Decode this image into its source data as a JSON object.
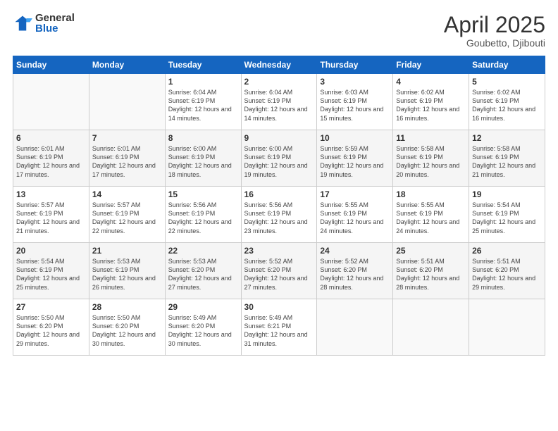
{
  "logo": {
    "general": "General",
    "blue": "Blue"
  },
  "title": {
    "month": "April 2025",
    "location": "Goubetto, Djibouti"
  },
  "headers": [
    "Sunday",
    "Monday",
    "Tuesday",
    "Wednesday",
    "Thursday",
    "Friday",
    "Saturday"
  ],
  "weeks": [
    [
      {
        "day": "",
        "info": ""
      },
      {
        "day": "",
        "info": ""
      },
      {
        "day": "1",
        "info": "Sunrise: 6:04 AM\nSunset: 6:19 PM\nDaylight: 12 hours and 14 minutes."
      },
      {
        "day": "2",
        "info": "Sunrise: 6:04 AM\nSunset: 6:19 PM\nDaylight: 12 hours and 14 minutes."
      },
      {
        "day": "3",
        "info": "Sunrise: 6:03 AM\nSunset: 6:19 PM\nDaylight: 12 hours and 15 minutes."
      },
      {
        "day": "4",
        "info": "Sunrise: 6:02 AM\nSunset: 6:19 PM\nDaylight: 12 hours and 16 minutes."
      },
      {
        "day": "5",
        "info": "Sunrise: 6:02 AM\nSunset: 6:19 PM\nDaylight: 12 hours and 16 minutes."
      }
    ],
    [
      {
        "day": "6",
        "info": "Sunrise: 6:01 AM\nSunset: 6:19 PM\nDaylight: 12 hours and 17 minutes."
      },
      {
        "day": "7",
        "info": "Sunrise: 6:01 AM\nSunset: 6:19 PM\nDaylight: 12 hours and 17 minutes."
      },
      {
        "day": "8",
        "info": "Sunrise: 6:00 AM\nSunset: 6:19 PM\nDaylight: 12 hours and 18 minutes."
      },
      {
        "day": "9",
        "info": "Sunrise: 6:00 AM\nSunset: 6:19 PM\nDaylight: 12 hours and 19 minutes."
      },
      {
        "day": "10",
        "info": "Sunrise: 5:59 AM\nSunset: 6:19 PM\nDaylight: 12 hours and 19 minutes."
      },
      {
        "day": "11",
        "info": "Sunrise: 5:58 AM\nSunset: 6:19 PM\nDaylight: 12 hours and 20 minutes."
      },
      {
        "day": "12",
        "info": "Sunrise: 5:58 AM\nSunset: 6:19 PM\nDaylight: 12 hours and 21 minutes."
      }
    ],
    [
      {
        "day": "13",
        "info": "Sunrise: 5:57 AM\nSunset: 6:19 PM\nDaylight: 12 hours and 21 minutes."
      },
      {
        "day": "14",
        "info": "Sunrise: 5:57 AM\nSunset: 6:19 PM\nDaylight: 12 hours and 22 minutes."
      },
      {
        "day": "15",
        "info": "Sunrise: 5:56 AM\nSunset: 6:19 PM\nDaylight: 12 hours and 22 minutes."
      },
      {
        "day": "16",
        "info": "Sunrise: 5:56 AM\nSunset: 6:19 PM\nDaylight: 12 hours and 23 minutes."
      },
      {
        "day": "17",
        "info": "Sunrise: 5:55 AM\nSunset: 6:19 PM\nDaylight: 12 hours and 24 minutes."
      },
      {
        "day": "18",
        "info": "Sunrise: 5:55 AM\nSunset: 6:19 PM\nDaylight: 12 hours and 24 minutes."
      },
      {
        "day": "19",
        "info": "Sunrise: 5:54 AM\nSunset: 6:19 PM\nDaylight: 12 hours and 25 minutes."
      }
    ],
    [
      {
        "day": "20",
        "info": "Sunrise: 5:54 AM\nSunset: 6:19 PM\nDaylight: 12 hours and 25 minutes."
      },
      {
        "day": "21",
        "info": "Sunrise: 5:53 AM\nSunset: 6:19 PM\nDaylight: 12 hours and 26 minutes."
      },
      {
        "day": "22",
        "info": "Sunrise: 5:53 AM\nSunset: 6:20 PM\nDaylight: 12 hours and 27 minutes."
      },
      {
        "day": "23",
        "info": "Sunrise: 5:52 AM\nSunset: 6:20 PM\nDaylight: 12 hours and 27 minutes."
      },
      {
        "day": "24",
        "info": "Sunrise: 5:52 AM\nSunset: 6:20 PM\nDaylight: 12 hours and 28 minutes."
      },
      {
        "day": "25",
        "info": "Sunrise: 5:51 AM\nSunset: 6:20 PM\nDaylight: 12 hours and 28 minutes."
      },
      {
        "day": "26",
        "info": "Sunrise: 5:51 AM\nSunset: 6:20 PM\nDaylight: 12 hours and 29 minutes."
      }
    ],
    [
      {
        "day": "27",
        "info": "Sunrise: 5:50 AM\nSunset: 6:20 PM\nDaylight: 12 hours and 29 minutes."
      },
      {
        "day": "28",
        "info": "Sunrise: 5:50 AM\nSunset: 6:20 PM\nDaylight: 12 hours and 30 minutes."
      },
      {
        "day": "29",
        "info": "Sunrise: 5:49 AM\nSunset: 6:20 PM\nDaylight: 12 hours and 30 minutes."
      },
      {
        "day": "30",
        "info": "Sunrise: 5:49 AM\nSunset: 6:21 PM\nDaylight: 12 hours and 31 minutes."
      },
      {
        "day": "",
        "info": ""
      },
      {
        "day": "",
        "info": ""
      },
      {
        "day": "",
        "info": ""
      }
    ]
  ]
}
